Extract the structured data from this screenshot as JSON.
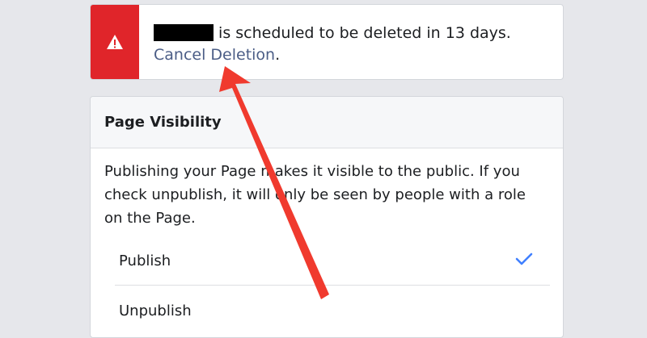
{
  "notice": {
    "message": "is scheduled to be deleted in 13 days.",
    "cancel_label": "Cancel Deletion",
    "cancel_suffix": ".",
    "accent_color": "#e0252a",
    "icon": "warning-icon"
  },
  "visibility": {
    "title": "Page Visibility",
    "description": "Publishing your Page makes it visible to the public. If you check unpublish, it will only be seen by people with a role on the Page.",
    "options": [
      {
        "label": "Publish",
        "selected": true
      },
      {
        "label": "Unpublish",
        "selected": false
      }
    ],
    "check_color": "#4080ff"
  },
  "annotation": {
    "arrow_color": "#f03a2e"
  }
}
